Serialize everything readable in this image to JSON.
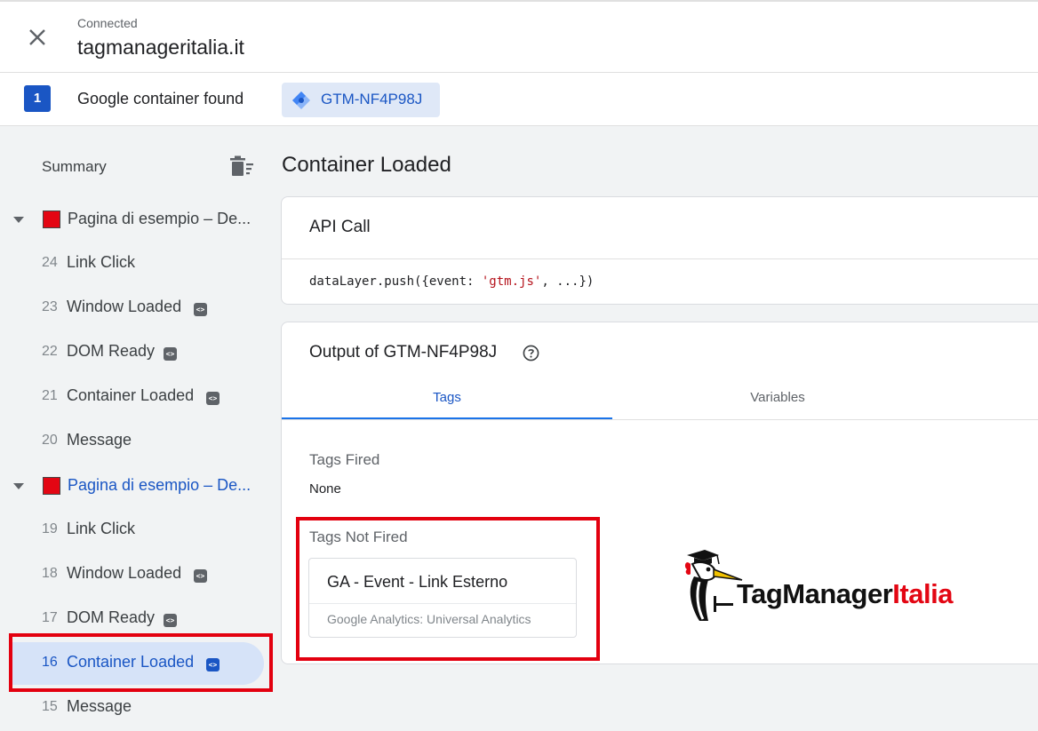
{
  "header": {
    "status": "Connected",
    "host": "tagmanageritalia.it"
  },
  "container_bar": {
    "count": "1",
    "label": "Google container found",
    "container_id": "GTM-NF4P98J"
  },
  "sidebar": {
    "summary": "Summary",
    "pages": [
      {
        "title": "Pagina di esempio – De...",
        "events": [
          {
            "num": "24",
            "name": "Link Click",
            "badge": false
          },
          {
            "num": "23",
            "name": "Window Loaded",
            "badge": true
          },
          {
            "num": "22",
            "name": "DOM Ready",
            "badge": true
          },
          {
            "num": "21",
            "name": "Container Loaded",
            "badge": true
          },
          {
            "num": "20",
            "name": "Message",
            "badge": false
          }
        ]
      },
      {
        "title": "Pagina di esempio – De...",
        "events": [
          {
            "num": "19",
            "name": "Link Click",
            "badge": false
          },
          {
            "num": "18",
            "name": "Window Loaded",
            "badge": true
          },
          {
            "num": "17",
            "name": "DOM Ready",
            "badge": true
          },
          {
            "num": "16",
            "name": "Container Loaded",
            "badge": true
          },
          {
            "num": "15",
            "name": "Message",
            "badge": false
          }
        ]
      }
    ]
  },
  "main": {
    "title": "Container Loaded",
    "api_card": {
      "title": "API Call",
      "code_prefix": "dataLayer.push({event: ",
      "code_string": "'gtm.js'",
      "code_suffix": ", ...})"
    },
    "output_card": {
      "title": "Output of GTM-NF4P98J",
      "tabs": [
        "Tags",
        "Variables"
      ],
      "tags_fired_label": "Tags Fired",
      "tags_fired_value": "None",
      "tags_not_fired_label": "Tags Not Fired",
      "tag": {
        "name": "GA - Event - Link Esterno",
        "type": "Google Analytics: Universal Analytics"
      }
    },
    "logo": {
      "part1": "TagManager",
      "part2": "Italia"
    }
  },
  "colors": {
    "accent": "#1a56c4",
    "highlight": "#e3000f",
    "selected_bg": "#d6e3f8"
  }
}
